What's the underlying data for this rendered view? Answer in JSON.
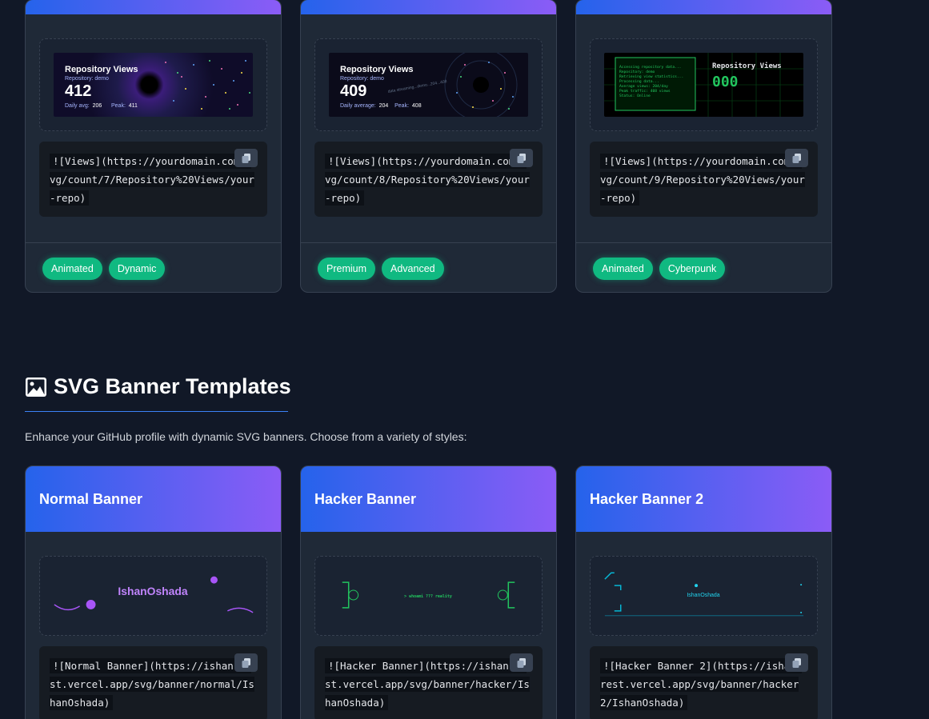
{
  "top_cards": [
    {
      "preview": {
        "title": "Repository Views",
        "repo": "Repository: demo",
        "count": "412",
        "avg_label": "Daily avg:",
        "avg": "206",
        "peak_label": "Peak:",
        "peak": "411"
      },
      "code": "![Views](https://yourdomain.com/svg/count/7/Repository%20Views/your-repo)",
      "tags": [
        "Animated",
        "Dynamic"
      ]
    },
    {
      "preview": {
        "title": "Repository Views",
        "repo": "Repository: demo",
        "count": "409",
        "avg_label": "Daily average:",
        "avg": "204",
        "peak_label": "Peak:",
        "peak": "408",
        "stream": "data streaming...demo...204...408"
      },
      "code": "![Views](https://yourdomain.com/svg/count/8/Repository%20Views/your-repo)",
      "tags": [
        "Premium",
        "Advanced"
      ]
    },
    {
      "preview": {
        "title": "Repository Views",
        "count": "000",
        "terminal": [
          "Accessing repository data...",
          "Repository: demo",
          "Retrieving view statistics...",
          "Processing data...",
          "Average views: 204/day",
          "Peak traffic: 408 views",
          "Status: Online"
        ]
      },
      "code": "![Views](https://yourdomain.com/svg/count/9/Repository%20Views/your-repo)",
      "tags": [
        "Animated",
        "Cyberpunk"
      ]
    }
  ],
  "section": {
    "title": "SVG Banner Templates",
    "icon": "image-icon",
    "description": "Enhance your GitHub profile with dynamic SVG banners. Choose from a variety of styles:"
  },
  "banner_cards": [
    {
      "title": "Normal Banner",
      "preview_name": "IshanOshada",
      "code": "![Normal Banner](https://ishan-rest.vercel.app/svg/banner/normal/IshanOshada)"
    },
    {
      "title": "Hacker Banner",
      "preview_text": "> whoami ??? reality",
      "code": "![Hacker Banner](https://ishan-rest.vercel.app/svg/banner/hacker/IshanOshada)"
    },
    {
      "title": "Hacker Banner 2",
      "preview_name": "IshanOshada",
      "code": "![Hacker Banner 2](https://ishan-rest.vercel.app/svg/banner/hacker2/IshanOshada)"
    }
  ],
  "colors": {
    "accent_start": "#2563eb",
    "accent_end": "#8b5cf6",
    "tag": "#10b981",
    "background": "#111827",
    "card": "#1f2937"
  }
}
